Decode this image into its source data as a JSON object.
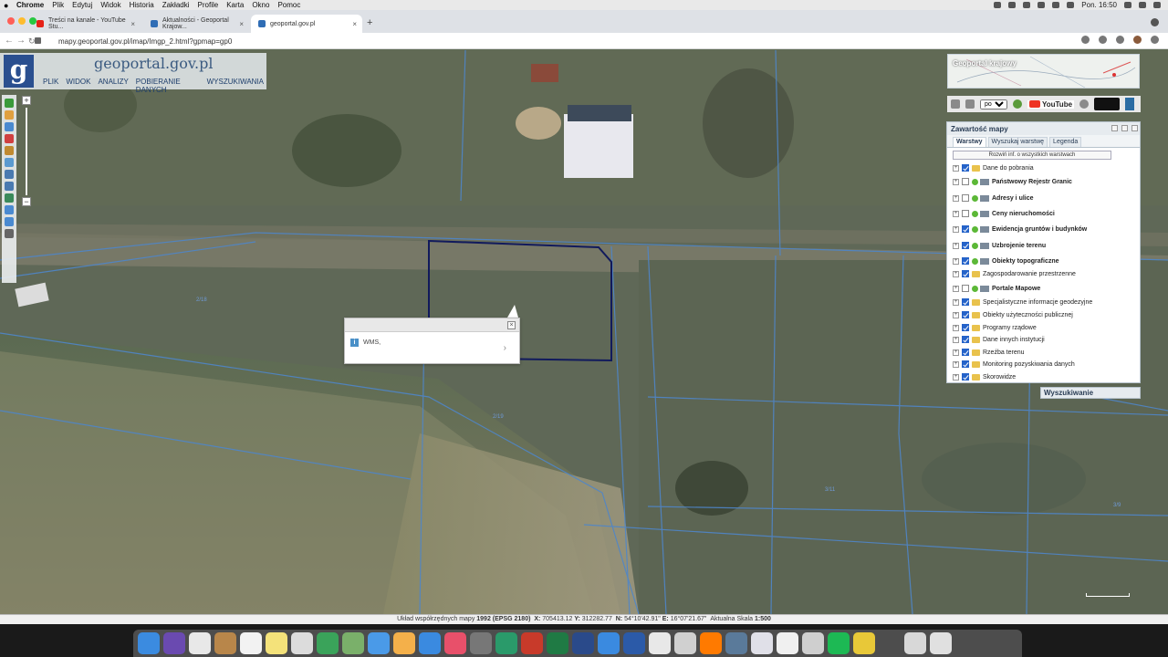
{
  "menubar": {
    "app": "Chrome",
    "items": [
      "Plik",
      "Edytuj",
      "Widok",
      "Historia",
      "Zakładki",
      "Profile",
      "Karta",
      "Okno",
      "Pomoc"
    ],
    "clock": "Pon. 16:50"
  },
  "tabs": [
    {
      "title": "Treści na kanale - YouTube Stu...",
      "color": "#e62117"
    },
    {
      "title": "Aktualności - Geoportal Krajow...",
      "color": "#2f6db5"
    },
    {
      "title": "geoportal.gov.pl",
      "color": "#2f6db5"
    }
  ],
  "address": {
    "url": "mapy.geoportal.gov.pl/imap/Imgp_2.html?gpmap=gp0"
  },
  "logo": {
    "letter": "g",
    "text": "geoportal.gov.pl"
  },
  "topmenu": [
    "PLIK",
    "WIDOK",
    "ANALIZY",
    "POBIERANIE DANYCH",
    "WYSZUKIWANIA"
  ],
  "zoom": {
    "plus": "+",
    "minus": "−"
  },
  "popup": {
    "text": "WMS,",
    "close": "×",
    "info": "i",
    "chevron": "›"
  },
  "overview": {
    "title": "Geoportal krajowy"
  },
  "rtools": {
    "lang": "pol",
    "youtube": "YouTube"
  },
  "layers_panel": {
    "title": "Zawartość mapy",
    "tabs": [
      "Warstwy",
      "Wyszukaj warstwę",
      "Legenda"
    ],
    "expand_all": "Rozwiń inf. o wszystkich warstwach",
    "layers": [
      {
        "label": "Dane do pobrania",
        "checked": true,
        "bold": false,
        "kind": "folder"
      },
      {
        "label": "Państwowy Rejestr Granic",
        "checked": false,
        "bold": true,
        "kind": "service"
      },
      {
        "label": "Adresy i ulice",
        "checked": false,
        "bold": true,
        "kind": "service"
      },
      {
        "label": "Ceny nieruchomości",
        "checked": false,
        "bold": true,
        "kind": "service"
      },
      {
        "label": "Ewidencja gruntów i budynków",
        "checked": true,
        "bold": true,
        "kind": "service"
      },
      {
        "label": "Uzbrojenie terenu",
        "checked": true,
        "bold": true,
        "kind": "service"
      },
      {
        "label": "Obiekty topograficzne",
        "checked": true,
        "bold": true,
        "kind": "service"
      },
      {
        "label": "Zagospodarowanie przestrzenne",
        "checked": true,
        "bold": false,
        "kind": "folder"
      },
      {
        "label": "Portale Mapowe",
        "checked": false,
        "bold": true,
        "kind": "service"
      },
      {
        "label": "Specjalistyczne informacje geodezyjne",
        "checked": true,
        "bold": false,
        "kind": "folder"
      },
      {
        "label": "Obiekty użyteczności publicznej",
        "checked": true,
        "bold": false,
        "kind": "folder"
      },
      {
        "label": "Programy rządowe",
        "checked": true,
        "bold": false,
        "kind": "folder"
      },
      {
        "label": "Dane innych instytucji",
        "checked": true,
        "bold": false,
        "kind": "folder"
      },
      {
        "label": "Rzeźba terenu",
        "checked": true,
        "bold": false,
        "kind": "folder"
      },
      {
        "label": "Monitoring pozyskiwania danych",
        "checked": true,
        "bold": false,
        "kind": "folder"
      },
      {
        "label": "Skorowidze",
        "checked": true,
        "bold": false,
        "kind": "folder"
      }
    ]
  },
  "search_panel": {
    "title": "Wyszukiwanie"
  },
  "status": {
    "prefix": "Układ współrzędnych mapy",
    "crs": "1992 (EPSG 2180)",
    "x_label": "X:",
    "x": "705413.12",
    "y_label": "Y:",
    "y": "312282.77",
    "n_label": "N:",
    "n": "54°10'42.91\"",
    "e_label": "E:",
    "e": "16°07'21.67\"",
    "scale_label": "Aktualna Skala",
    "scale": "1:500"
  }
}
